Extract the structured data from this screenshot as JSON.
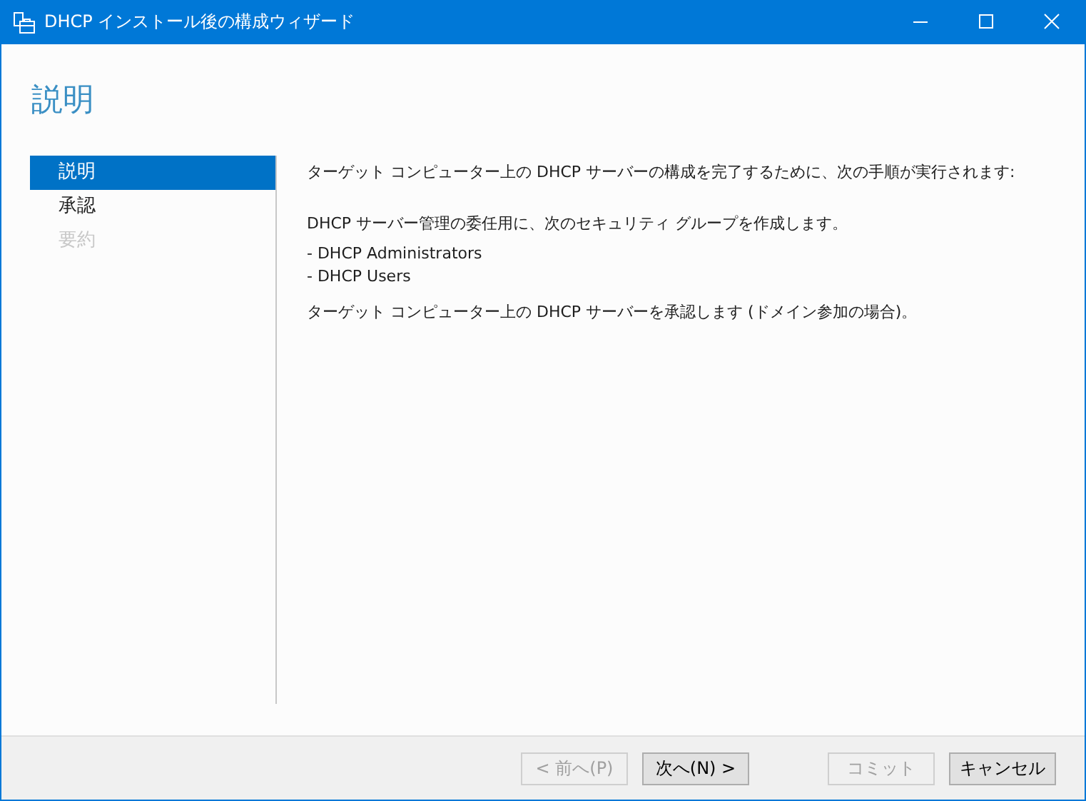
{
  "window": {
    "title": "DHCP インストール後の構成ウィザード"
  },
  "page_title": "説明",
  "steps": [
    {
      "label": "説明",
      "selected": true,
      "disabled": false
    },
    {
      "label": "承認",
      "selected": false,
      "disabled": false
    },
    {
      "label": "要約",
      "selected": false,
      "disabled": true
    }
  ],
  "content": {
    "intro": "ターゲット コンピューター上の DHCP サーバーの構成を完了するために、次の手順が実行されます:",
    "groups_intro": "DHCP サーバー管理の委任用に、次のセキュリティ グループを作成します。",
    "groups": [
      "- DHCP Administrators",
      "- DHCP Users"
    ],
    "authorize": "ターゲット コンピューター上の DHCP サーバーを承認します (ドメイン参加の場合)。"
  },
  "nav_buttons": [
    {
      "label": "< 前へ(P)",
      "disabled": true
    },
    {
      "label": "次へ(N) >",
      "disabled": false
    }
  ],
  "action_buttons": [
    {
      "label": "コミット",
      "disabled": true
    },
    {
      "label": "キャンセル",
      "disabled": false
    }
  ]
}
